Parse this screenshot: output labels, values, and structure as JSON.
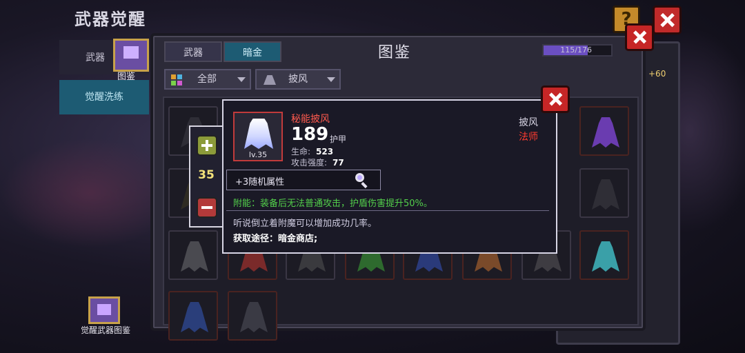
{
  "background": {
    "title": "武器觉醒",
    "side_tabs": [
      "武器",
      "觉醒洗练"
    ],
    "help_label": "?",
    "bottom_label": "觉醒武器图鉴"
  },
  "panel": {
    "icon_label": "图鉴",
    "title": "图鉴",
    "tabs": [
      {
        "label": "武器",
        "active": false
      },
      {
        "label": "暗金",
        "active": true
      }
    ],
    "progress": {
      "text": "115/176",
      "value": 115,
      "max": 176
    },
    "side_badge": "+60",
    "filters": [
      {
        "label": "全部",
        "icon": "grid-icon"
      },
      {
        "label": "披风",
        "icon": "cape-icon"
      }
    ]
  },
  "counter": {
    "value": "35"
  },
  "popup": {
    "item_name": "秘能披风",
    "item_level": "lv.35",
    "power": "189",
    "power_unit": "护甲",
    "stats": [
      {
        "label": "生命:",
        "value": "523"
      },
      {
        "label": "攻击强度:",
        "value": "77"
      }
    ],
    "type": "披风",
    "class": "法师",
    "random_attr": "+3随机属性",
    "enchant": "附能：装备后无法普通攻击，护盾伤害提升50%。",
    "description": "听说倒立着附魔可以增加成功几率。",
    "source": "获取途径：暗金商店;"
  },
  "colors": {
    "accent_blue": "#1d5b73",
    "close_red": "#c62626",
    "item_name_red": "#ff5a4e",
    "enchant_green": "#53d04b",
    "counter_yellow": "#f3e27a"
  }
}
